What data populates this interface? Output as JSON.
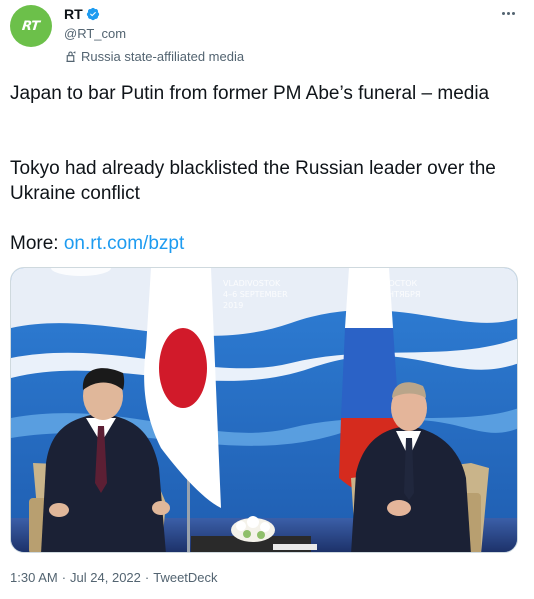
{
  "account": {
    "display_name": "RT",
    "handle": "@RT_com",
    "affiliation": "Russia state-affiliated media",
    "avatar_text": "RT",
    "avatar_color": "#6cc04a",
    "verified_color": "#1d9bf0"
  },
  "tweet": {
    "line1": "Japan to bar Putin from former PM Abe’s funeral – media",
    "line2": "Tokyo had already blacklisted the Russian leader over the Ukraine conflict",
    "more_prefix": "More: ",
    "link_text": "on.rt.com/bzpt",
    "link_color": "#1d9bf0"
  },
  "media": {
    "banner_left": [
      "VLADIVOSTOK",
      "4–6 SEPTEMBER",
      "2019"
    ],
    "banner_right": [
      "ВОСТОК",
      "ЕНТЯБРЯ"
    ]
  },
  "meta": {
    "time": "1:30 AM",
    "date": "Jul 24, 2022",
    "source": "TweetDeck",
    "separator": "·"
  }
}
